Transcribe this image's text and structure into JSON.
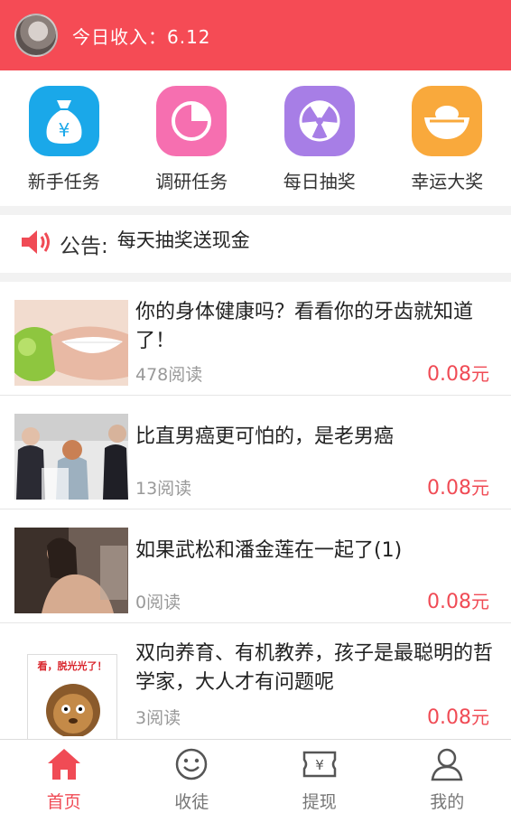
{
  "header": {
    "income_label": "今日收入：6.12"
  },
  "quick_actions": [
    {
      "label": "新手任务",
      "icon": "money-bag-icon",
      "color": "#1aa8e9"
    },
    {
      "label": "调研任务",
      "icon": "pie-chart-icon",
      "color": "#f66fb0"
    },
    {
      "label": "每日抽奖",
      "icon": "lottery-wheel-icon",
      "color": "#a77ee6"
    },
    {
      "label": "幸运大奖",
      "icon": "gold-ingot-icon",
      "color": "#f9a93c"
    }
  ],
  "notice": {
    "title": "公告:",
    "text": "每天抽奖送现金"
  },
  "articles": [
    {
      "title": "你的身体健康吗？看看你的牙齿就知道了！",
      "reads": "478阅读",
      "reward": "0.08",
      "unit": "元"
    },
    {
      "title": "比直男癌更可怕的，是老男癌",
      "reads": "13阅读",
      "reward": "0.08",
      "unit": "元"
    },
    {
      "title": "如果武松和潘金莲在一起了(1)",
      "reads": "0阅读",
      "reward": "0.08",
      "unit": "元"
    },
    {
      "title": "双向养育、有机教养，孩子是最聪明的哲学家，大人才有问题呢",
      "reads": "3阅读",
      "reward": "0.08",
      "unit": "元",
      "thumb_text": "看，脱光光了！"
    }
  ],
  "tabs": [
    {
      "label": "首页",
      "icon": "home-icon",
      "active": true
    },
    {
      "label": "收徒",
      "icon": "smiley-icon",
      "active": false
    },
    {
      "label": "提现",
      "icon": "withdraw-yen-icon",
      "active": false
    },
    {
      "label": "我的",
      "icon": "user-icon",
      "active": false
    }
  ],
  "colors": {
    "accent": "#f54b55",
    "reward": "#f04b55",
    "muted": "#999999"
  }
}
